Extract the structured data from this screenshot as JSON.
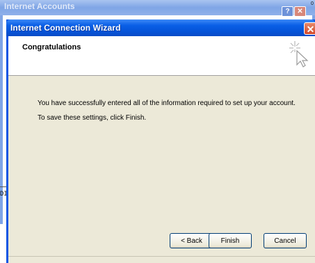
{
  "background_window": {
    "title": "Internet Accounts",
    "help_label": "?",
    "close_label": "✕",
    "corner_text": "0",
    "side_text": "DI"
  },
  "wizard": {
    "title": "Internet Connection Wizard",
    "close_label": "✕",
    "header_title": "Congratulations",
    "header_icon": "cursor-sparkle-icon",
    "line1": "You have successfully entered all of the information required to set up your account.",
    "line2": "To save these settings, click Finish.",
    "buttons": {
      "back": "< Back",
      "finish": "Finish",
      "cancel": "Cancel"
    }
  },
  "colors": {
    "titlebar": "#0554d9",
    "dialog_bg": "#ece9d8",
    "close": "#d4492a"
  }
}
